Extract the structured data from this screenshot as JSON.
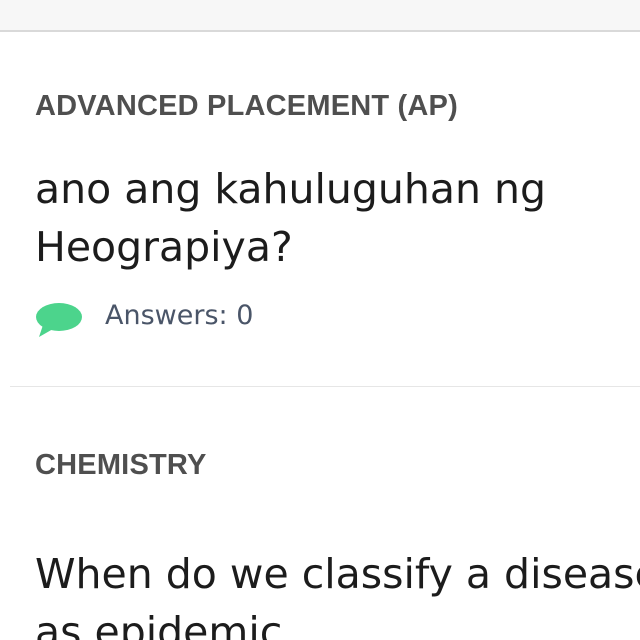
{
  "feed": {
    "questions": [
      {
        "subject": "ADVANCED PLACEMENT (AP)",
        "text": "ano ang kahuluguhan ng\nHeograpiya?",
        "answers_label": "Answers: 0",
        "answers_count": 0
      },
      {
        "subject": "CHEMISTRY",
        "text": "When do we classify a disease\nas epidemic"
      }
    ]
  },
  "icons": {
    "answers": "chat-bubble-icon"
  },
  "colors": {
    "subject": "#4f4f4f",
    "question": "#1c1c1c",
    "answers_text": "#4a5568",
    "chat_icon": "#4cd48c",
    "divider": "#e6e6e6",
    "topbar": "#f7f7f7"
  }
}
